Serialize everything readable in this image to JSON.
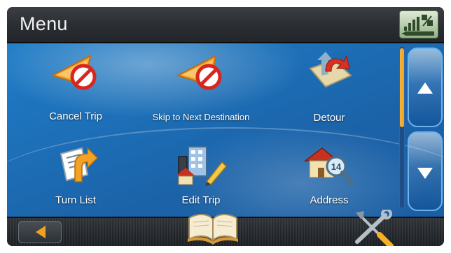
{
  "header": {
    "title": "Menu",
    "status_icon": "signal-battery-icon"
  },
  "menu": {
    "items": [
      {
        "label": "Cancel Trip",
        "icon": "cancel-trip-icon"
      },
      {
        "label": "Skip to Next Destination",
        "icon": "skip-destination-icon"
      },
      {
        "label": "Detour",
        "icon": "detour-icon"
      },
      {
        "label": "Turn List",
        "icon": "turn-list-icon"
      },
      {
        "label": "Edit Trip",
        "icon": "edit-trip-icon"
      },
      {
        "label": "Address",
        "icon": "address-icon"
      }
    ]
  },
  "address_badge": "14",
  "scroll": {
    "thumb_fraction": 0.5,
    "up_icon": "arrow-up-icon",
    "down_icon": "arrow-down-icon"
  },
  "footer": {
    "back_icon": "back-arrow-icon",
    "manual_icon": "open-book-icon",
    "tools_icon": "tools-icon"
  },
  "colors": {
    "background_blue": "#1d6fb7",
    "accent_orange": "#f0a21f",
    "header_dark": "#2a2d31"
  }
}
